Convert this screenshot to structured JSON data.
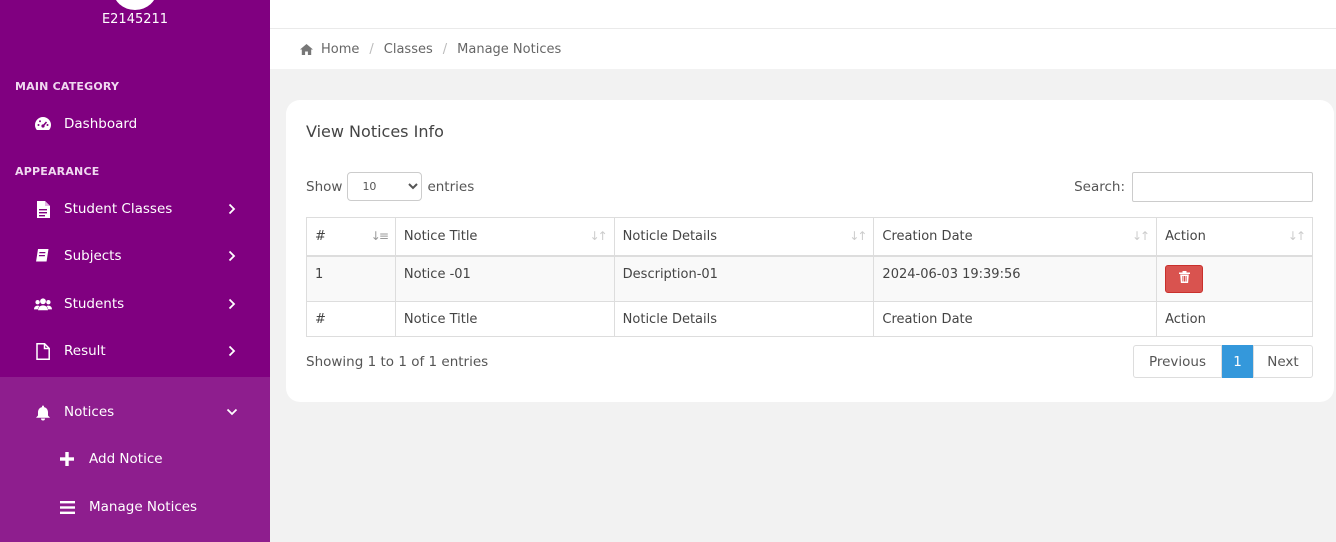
{
  "sidebar": {
    "user_id": "E2145211",
    "sections": [
      "MAIN CATEGORY",
      "APPEARANCE"
    ],
    "dashboard": "Dashboard",
    "items": [
      {
        "label": "Student Classes",
        "icon": "file-icon"
      },
      {
        "label": "Subjects",
        "icon": "book-icon"
      },
      {
        "label": "Students",
        "icon": "users-icon"
      },
      {
        "label": "Result",
        "icon": "file-outline-icon"
      }
    ],
    "notices": {
      "label": "Notices",
      "sub": [
        "Add Notice",
        "Manage Notices"
      ]
    }
  },
  "breadcrumb": [
    "Home",
    "Classes",
    "Manage Notices"
  ],
  "card": {
    "title": "View Notices Info",
    "show_label": "Show",
    "entries_label": "entries",
    "page_size": "10",
    "search_label": "Search:",
    "columns": [
      "#",
      "Notice Title",
      "Noticle Details",
      "Creation Date",
      "Action"
    ],
    "rows": [
      {
        "num": "1",
        "title": "Notice -01",
        "details": "Description-01",
        "date": "2024-06-03 19:39:56"
      }
    ],
    "info": "Showing 1 to 1 of 1 entries",
    "pager": {
      "prev": "Previous",
      "page": "1",
      "next": "Next"
    }
  },
  "colors": {
    "sidebar": "#800080",
    "submenu": "#8e1e8e",
    "danger": "#d9534f",
    "primary": "#3498db"
  }
}
